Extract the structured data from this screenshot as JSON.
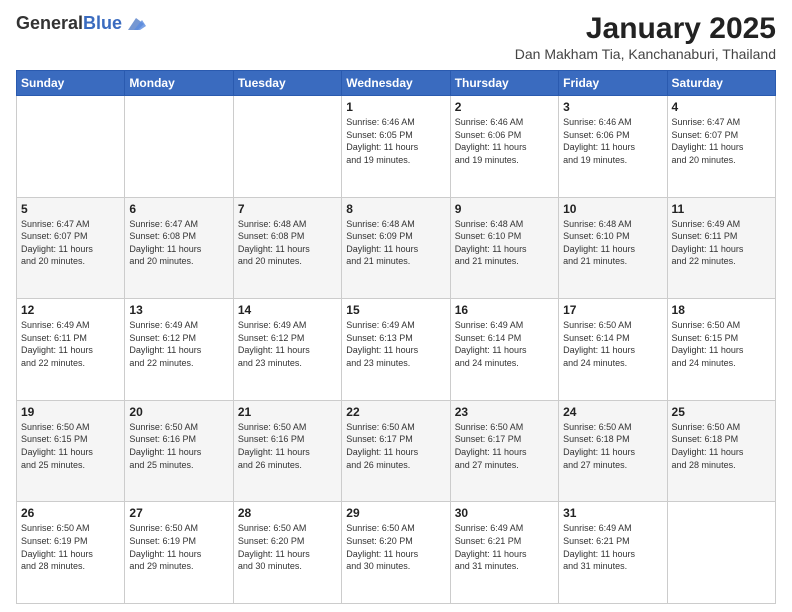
{
  "header": {
    "logo": {
      "general": "General",
      "blue": "Blue"
    },
    "title": "January 2025",
    "location": "Dan Makham Tia, Kanchanaburi, Thailand"
  },
  "weekdays": [
    "Sunday",
    "Monday",
    "Tuesday",
    "Wednesday",
    "Thursday",
    "Friday",
    "Saturday"
  ],
  "weeks": [
    [
      {
        "day": "",
        "info": ""
      },
      {
        "day": "",
        "info": ""
      },
      {
        "day": "",
        "info": ""
      },
      {
        "day": "1",
        "info": "Sunrise: 6:46 AM\nSunset: 6:05 PM\nDaylight: 11 hours\nand 19 minutes."
      },
      {
        "day": "2",
        "info": "Sunrise: 6:46 AM\nSunset: 6:06 PM\nDaylight: 11 hours\nand 19 minutes."
      },
      {
        "day": "3",
        "info": "Sunrise: 6:46 AM\nSunset: 6:06 PM\nDaylight: 11 hours\nand 19 minutes."
      },
      {
        "day": "4",
        "info": "Sunrise: 6:47 AM\nSunset: 6:07 PM\nDaylight: 11 hours\nand 20 minutes."
      }
    ],
    [
      {
        "day": "5",
        "info": "Sunrise: 6:47 AM\nSunset: 6:07 PM\nDaylight: 11 hours\nand 20 minutes."
      },
      {
        "day": "6",
        "info": "Sunrise: 6:47 AM\nSunset: 6:08 PM\nDaylight: 11 hours\nand 20 minutes."
      },
      {
        "day": "7",
        "info": "Sunrise: 6:48 AM\nSunset: 6:08 PM\nDaylight: 11 hours\nand 20 minutes."
      },
      {
        "day": "8",
        "info": "Sunrise: 6:48 AM\nSunset: 6:09 PM\nDaylight: 11 hours\nand 21 minutes."
      },
      {
        "day": "9",
        "info": "Sunrise: 6:48 AM\nSunset: 6:10 PM\nDaylight: 11 hours\nand 21 minutes."
      },
      {
        "day": "10",
        "info": "Sunrise: 6:48 AM\nSunset: 6:10 PM\nDaylight: 11 hours\nand 21 minutes."
      },
      {
        "day": "11",
        "info": "Sunrise: 6:49 AM\nSunset: 6:11 PM\nDaylight: 11 hours\nand 22 minutes."
      }
    ],
    [
      {
        "day": "12",
        "info": "Sunrise: 6:49 AM\nSunset: 6:11 PM\nDaylight: 11 hours\nand 22 minutes."
      },
      {
        "day": "13",
        "info": "Sunrise: 6:49 AM\nSunset: 6:12 PM\nDaylight: 11 hours\nand 22 minutes."
      },
      {
        "day": "14",
        "info": "Sunrise: 6:49 AM\nSunset: 6:12 PM\nDaylight: 11 hours\nand 23 minutes."
      },
      {
        "day": "15",
        "info": "Sunrise: 6:49 AM\nSunset: 6:13 PM\nDaylight: 11 hours\nand 23 minutes."
      },
      {
        "day": "16",
        "info": "Sunrise: 6:49 AM\nSunset: 6:14 PM\nDaylight: 11 hours\nand 24 minutes."
      },
      {
        "day": "17",
        "info": "Sunrise: 6:50 AM\nSunset: 6:14 PM\nDaylight: 11 hours\nand 24 minutes."
      },
      {
        "day": "18",
        "info": "Sunrise: 6:50 AM\nSunset: 6:15 PM\nDaylight: 11 hours\nand 24 minutes."
      }
    ],
    [
      {
        "day": "19",
        "info": "Sunrise: 6:50 AM\nSunset: 6:15 PM\nDaylight: 11 hours\nand 25 minutes."
      },
      {
        "day": "20",
        "info": "Sunrise: 6:50 AM\nSunset: 6:16 PM\nDaylight: 11 hours\nand 25 minutes."
      },
      {
        "day": "21",
        "info": "Sunrise: 6:50 AM\nSunset: 6:16 PM\nDaylight: 11 hours\nand 26 minutes."
      },
      {
        "day": "22",
        "info": "Sunrise: 6:50 AM\nSunset: 6:17 PM\nDaylight: 11 hours\nand 26 minutes."
      },
      {
        "day": "23",
        "info": "Sunrise: 6:50 AM\nSunset: 6:17 PM\nDaylight: 11 hours\nand 27 minutes."
      },
      {
        "day": "24",
        "info": "Sunrise: 6:50 AM\nSunset: 6:18 PM\nDaylight: 11 hours\nand 27 minutes."
      },
      {
        "day": "25",
        "info": "Sunrise: 6:50 AM\nSunset: 6:18 PM\nDaylight: 11 hours\nand 28 minutes."
      }
    ],
    [
      {
        "day": "26",
        "info": "Sunrise: 6:50 AM\nSunset: 6:19 PM\nDaylight: 11 hours\nand 28 minutes."
      },
      {
        "day": "27",
        "info": "Sunrise: 6:50 AM\nSunset: 6:19 PM\nDaylight: 11 hours\nand 29 minutes."
      },
      {
        "day": "28",
        "info": "Sunrise: 6:50 AM\nSunset: 6:20 PM\nDaylight: 11 hours\nand 30 minutes."
      },
      {
        "day": "29",
        "info": "Sunrise: 6:50 AM\nSunset: 6:20 PM\nDaylight: 11 hours\nand 30 minutes."
      },
      {
        "day": "30",
        "info": "Sunrise: 6:49 AM\nSunset: 6:21 PM\nDaylight: 11 hours\nand 31 minutes."
      },
      {
        "day": "31",
        "info": "Sunrise: 6:49 AM\nSunset: 6:21 PM\nDaylight: 11 hours\nand 31 minutes."
      },
      {
        "day": "",
        "info": ""
      }
    ]
  ]
}
